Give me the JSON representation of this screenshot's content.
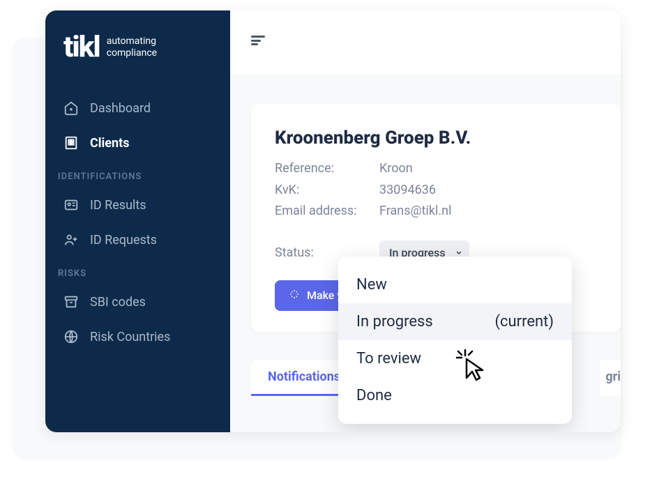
{
  "brand": {
    "name": "tikl",
    "tagline1": "automating",
    "tagline2": "compliance"
  },
  "sidebar": {
    "items": [
      {
        "label": "Dashboard"
      },
      {
        "label": "Clients"
      }
    ],
    "sections": [
      {
        "heading": "IDENTIFICATIONS",
        "items": [
          {
            "label": "ID Results"
          },
          {
            "label": "ID Requests"
          }
        ]
      },
      {
        "heading": "RISKS",
        "items": [
          {
            "label": "SBI codes"
          },
          {
            "label": "Risk Countries"
          }
        ]
      }
    ]
  },
  "client": {
    "name": "Kroonenberg Groep B.V.",
    "fields": [
      {
        "label": "Reference:",
        "value": "Kroon"
      },
      {
        "label": "KvK:",
        "value": "33094636"
      },
      {
        "label": "Email address:",
        "value": "Frans@tikl.nl"
      }
    ],
    "status_label": "Status:",
    "status_value": "In progress",
    "action_button": "Make your se"
  },
  "tabs": [
    {
      "label": "Notifications",
      "active": true
    },
    {
      "label": "gri",
      "active": false
    }
  ],
  "dropdown": {
    "options": [
      {
        "label": "New",
        "current": false
      },
      {
        "label": "In progress",
        "current": true
      },
      {
        "label": "To review",
        "current": false
      },
      {
        "label": "Done",
        "current": false
      }
    ],
    "current_marker": "(current)"
  }
}
